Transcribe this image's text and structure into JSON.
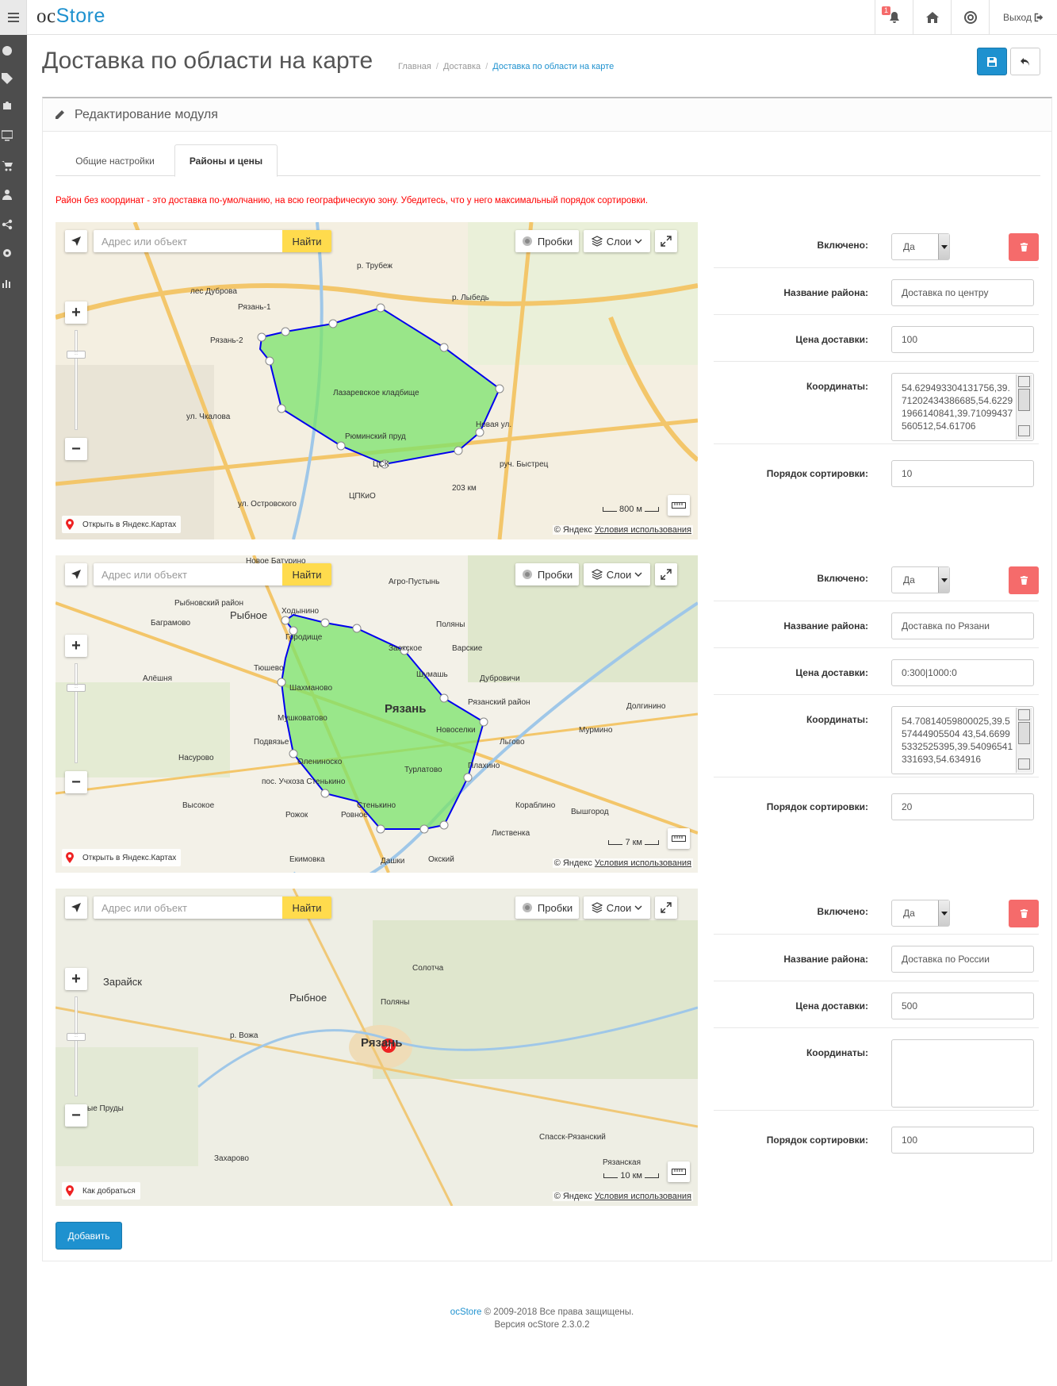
{
  "app": {
    "logo_oc": "oc",
    "logo_store": "Store",
    "notifications_count": "1",
    "logout_label": "Выход"
  },
  "page": {
    "title": "Доставка по области на карте",
    "breadcrumb": [
      "Главная",
      "Доставка",
      "Доставка по области на карте"
    ]
  },
  "panel": {
    "title": "Редактирование модуля",
    "tabs": [
      {
        "label": "Общие настройки",
        "active": false
      },
      {
        "label": "Районы и цены",
        "active": true
      }
    ],
    "notice": "Район без координат - это доставка по-умолчанию, на всю географическую зону. Убедитесь, что у него максимальный порядок сортировки."
  },
  "labels": {
    "enabled": "Включено:",
    "name": "Название района:",
    "price": "Цена доставки:",
    "coords": "Координаты:",
    "sort": "Порядок сортировки:"
  },
  "map_ui": {
    "search_placeholder": "Адрес или объект",
    "find": "Найти",
    "traffic": "Пробки",
    "layers": "Слои",
    "copyright": "© Яндекс",
    "terms": "Условия использования"
  },
  "zones": [
    {
      "enabled": "Да",
      "name": "Доставка по центру",
      "price": "100",
      "coords": "54.629493304131756,39.71202434386685,54.62291966140841,39.71099437560512,54.61706",
      "sort": "10",
      "map_link": "Открыть в Яндекс.Картах",
      "scale": "800 м",
      "map_labels": [
        "р. Трубеж",
        "лес Дуброва",
        "Рязань-1",
        "Рязань-2",
        "ул. Чкалова",
        "Лазаревское кладбище",
        "Рюминский пруд",
        "Новая ул.",
        "ЦСК",
        "ЦПКиО",
        "ул. Островского",
        "р. Лыбедь",
        "руч. Быстрец",
        "203 км"
      ]
    },
    {
      "enabled": "Да",
      "name": "Доставка по Рязани",
      "price": "0:300|1000:0",
      "coords": "54.70814059800025,39.557444905504 43,54.66995332525395,39.54096541331693,54.634916",
      "sort": "20",
      "map_link": "Открыть в Яндекс.Картах",
      "scale": "7 км",
      "map_labels": [
        "Новое Батурино",
        "Агро-Пустынь",
        "Рыбновский район",
        "Рыбное",
        "Ходынино",
        "Баграмово",
        "Поляны",
        "Городище",
        "Заокское",
        "Варские",
        "Тюшево",
        "Алёшня",
        "Шумашь",
        "Дубровичи",
        "Шахманово",
        "Рязань",
        "Рязанский район",
        "Долгинино",
        "Мушковатово",
        "Новоселки",
        "Мурмино",
        "Подвязье",
        "Льгово",
        "Насурово",
        "Олениноско",
        "Турлатово",
        "Плахино",
        "пос. Учхоза Стенькино",
        "Стенькино",
        "Кораблино",
        "Высокое",
        "Вышгород",
        "Рожок",
        "Ровное",
        "Лиственка",
        "Дашки",
        "Екимовка",
        "Окский"
      ]
    },
    {
      "enabled": "Да",
      "name": "Доставка по России",
      "price": "500",
      "coords": "",
      "sort": "100",
      "map_link": "Как добраться",
      "scale": "10 км",
      "map_labels": [
        "Зарайск",
        "Солотча",
        "Рыбное",
        "Поляны",
        "Рязань",
        "р. Вожа",
        "ые Пруды",
        "Спасск-Рязанский",
        "Захарово",
        "Рязанская"
      ]
    }
  ],
  "add_button": "Добавить",
  "footer": {
    "brand": "ocStore",
    "copyright": "© 2009-2018 Все права защищены.",
    "version": "Версия ocStore 2.3.0.2"
  },
  "colors": {
    "accent": "#1e91cf",
    "danger": "#f56b6b",
    "zone_fill": "#7be36b",
    "zone_stroke": "#0000ee",
    "notice": "#ff0000"
  }
}
